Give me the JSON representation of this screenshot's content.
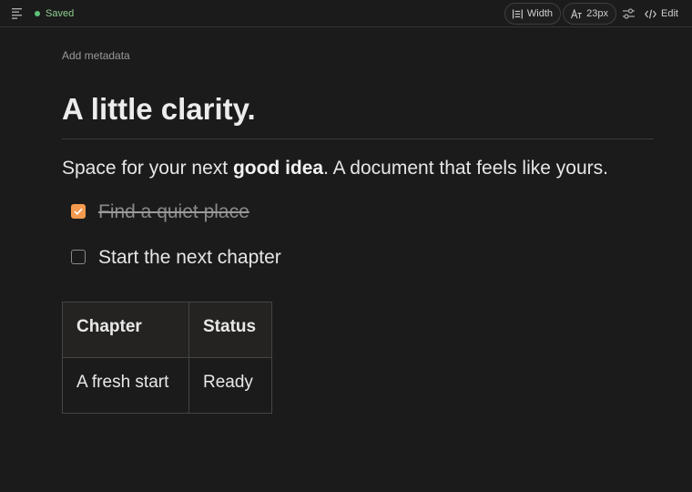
{
  "toolbar": {
    "status_label": "Saved",
    "width_label": "Width",
    "font_size_label": "23px",
    "edit_label": "Edit"
  },
  "document": {
    "metadata_label": "Add metadata",
    "title": "A little clarity.",
    "paragraph": {
      "before": "Space for your next ",
      "bold": "good idea",
      "after": ". A document that feels like yours."
    },
    "tasks": [
      {
        "text": "Find a quiet place",
        "checked": true
      },
      {
        "text": "Start the next chapter",
        "checked": false
      }
    ],
    "table": {
      "headers": [
        "Chapter",
        "Status"
      ],
      "rows": [
        [
          "A fresh start",
          "Ready"
        ]
      ]
    }
  },
  "colors": {
    "accent": "#f39a4f",
    "status_green": "#5ec27a",
    "background": "#1b1b1b"
  },
  "icons": [
    "menu-icon",
    "width-icon",
    "font-size-icon",
    "sliders-icon",
    "code-icon",
    "check-icon"
  ]
}
